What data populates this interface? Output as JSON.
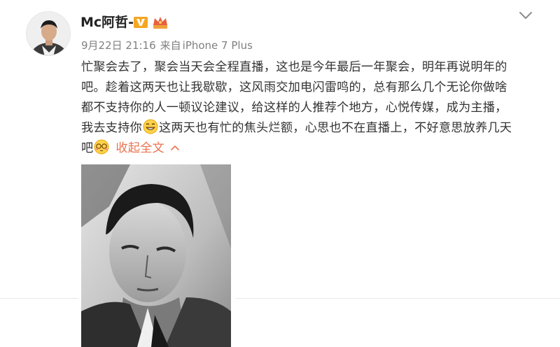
{
  "user": {
    "name": "Mc阿哲-"
  },
  "post": {
    "date": "9月22日 21:16",
    "source_prefix": "来自",
    "source_device": "iPhone 7 Plus",
    "lines": [
      "忙聚会去了，聚会当天会全程直播，这也是今年最后一年聚会，明年再说明年的",
      "吧。趁着这两天也让我歇歇，这风雨交加电闪雷鸣的，总有那么几个无论你做啥",
      "都不支持你的人一顿议论建议，给这样的人推荐个地方，心悦传媒，成为主播，"
    ],
    "line4_before": "我去支持你",
    "line4_after": "这两天也有忙的焦头烂额，心思也不在直播上，不好意思放养几天",
    "line5": "吧",
    "collapse_label": "收起全文"
  },
  "icons": {
    "vip": "verified-v-badge-icon",
    "crown": "member-crown-icon",
    "menu": "chevron-down-icon",
    "emoji1": "grin-emoji-icon",
    "emoji2": "shy-emoji-icon",
    "caret": "caret-up-icon"
  },
  "colors": {
    "accent": "#eb7350",
    "verified": "#f5a623",
    "crown": "#e8613f",
    "meta_text": "#808080",
    "body_text": "#333333"
  }
}
